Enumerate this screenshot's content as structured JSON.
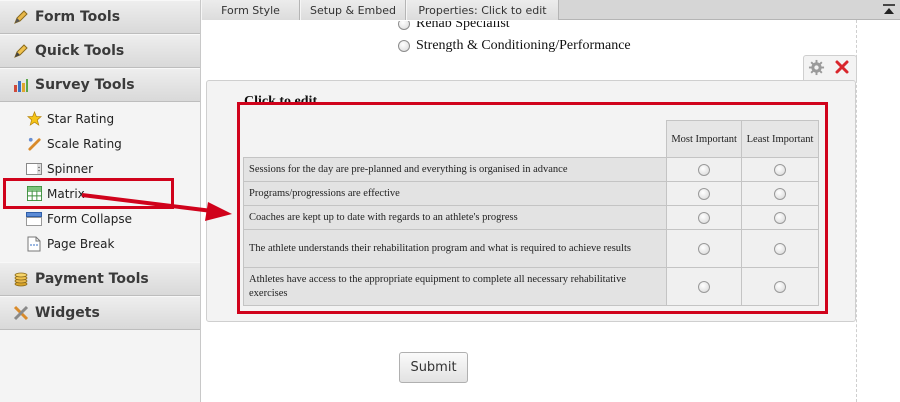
{
  "sidebar": {
    "categories": {
      "form_tools": "Form Tools",
      "quick_tools": "Quick Tools",
      "survey_tools": "Survey Tools",
      "payment_tools": "Payment Tools",
      "widgets": "Widgets"
    },
    "survey_items": [
      {
        "label": "Star Rating",
        "icon": "star-icon"
      },
      {
        "label": "Scale Rating",
        "icon": "scale-icon"
      },
      {
        "label": "Spinner",
        "icon": "spinner-icon"
      },
      {
        "label": "Matrix",
        "icon": "matrix-icon"
      },
      {
        "label": "Form Collapse",
        "icon": "collapse-icon"
      },
      {
        "label": "Page Break",
        "icon": "page-break-icon"
      }
    ]
  },
  "tabs": [
    "Form Style",
    "Setup & Embed",
    "Properties: Click to edit"
  ],
  "form": {
    "options": [
      "Rehab Specialist",
      "Strength & Conditioning/Performance"
    ],
    "question_label": "Click to edit",
    "matrix": {
      "columns": [
        "Most Important",
        "Least Important"
      ],
      "rows": [
        "Sessions for the day are pre-planned and everything is organised in advance",
        "Programs/progressions are effective",
        "Coaches are kept up to date with regards to an athlete's progress",
        "The athlete understands their rehabilitation program and what is required to achieve results",
        "Athletes have access to the appropriate equipment to complete all necessary rehabilitative exercises"
      ]
    },
    "submit_label": "Submit"
  },
  "colors": {
    "annotation_red": "#d0021b",
    "delete_red": "#d9262c"
  }
}
